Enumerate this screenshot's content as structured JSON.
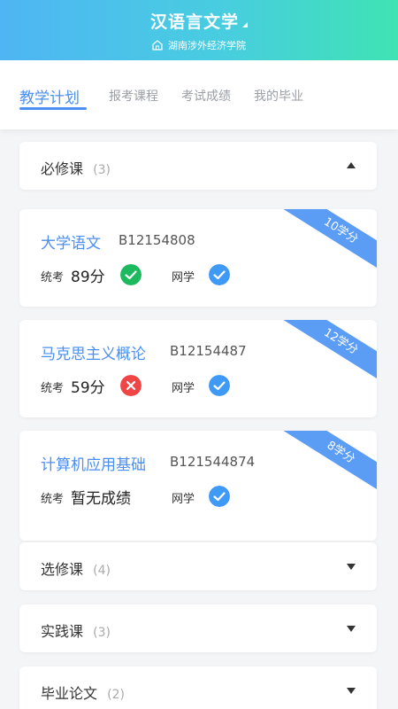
{
  "header": {
    "title": "汉语言文学",
    "school": "湖南涉外经济学院"
  },
  "tabs": [
    {
      "label": "教学计划",
      "active": true
    },
    {
      "label": "报考课程",
      "active": false
    },
    {
      "label": "考试成绩",
      "active": false
    },
    {
      "label": "我的毕业",
      "active": false
    }
  ],
  "sections": {
    "required": {
      "label": "必修课",
      "count": "(3)",
      "expanded": true
    },
    "elective": {
      "label": "选修课",
      "count": "(4)",
      "expanded": false
    },
    "practice": {
      "label": "实践课",
      "count": "(3)",
      "expanded": false
    },
    "thesis": {
      "label": "毕业论文",
      "count": "(2)",
      "expanded": false
    }
  },
  "courses": [
    {
      "name": "大学语文",
      "code": "B12154808",
      "credits": "10学分",
      "exam_label": "统考",
      "score": "89分",
      "exam_status": "pass",
      "net_label": "网学",
      "net_status": "done"
    },
    {
      "name": "马克思主义概论",
      "code": "B12154487",
      "credits": "12学分",
      "exam_label": "统考",
      "score": "59分",
      "exam_status": "fail",
      "net_label": "网学",
      "net_status": "done"
    },
    {
      "name": "计算机应用基础",
      "code": "B121544874",
      "credits": "8学分",
      "exam_label": "统考",
      "score": "暂无成绩",
      "exam_status": "none",
      "net_label": "网学",
      "net_status": "done"
    }
  ],
  "colors": {
    "accent": "#4b8ff0",
    "pass": "#1cb95f",
    "fail": "#f04545",
    "net": "#3f9af5"
  }
}
